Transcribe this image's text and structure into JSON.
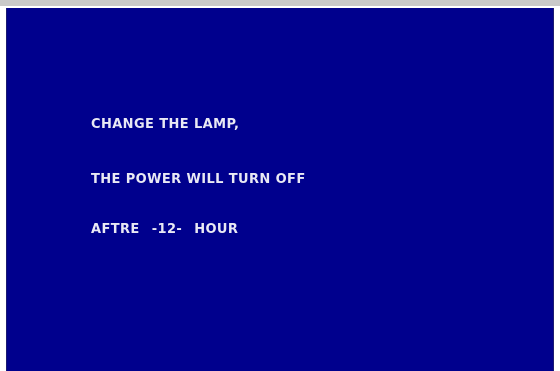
{
  "colors": {
    "screen_background": "#00008d",
    "text": "#e9e9f4",
    "top_edge": "#c9c9c9"
  },
  "osd": {
    "line1": "CHANGE THE LAMP,",
    "line2": "THE POWER WILL TURN OFF",
    "line3_prefix": "AFTRE",
    "line3_value": "-12-",
    "line3_suffix": "HOUR"
  }
}
